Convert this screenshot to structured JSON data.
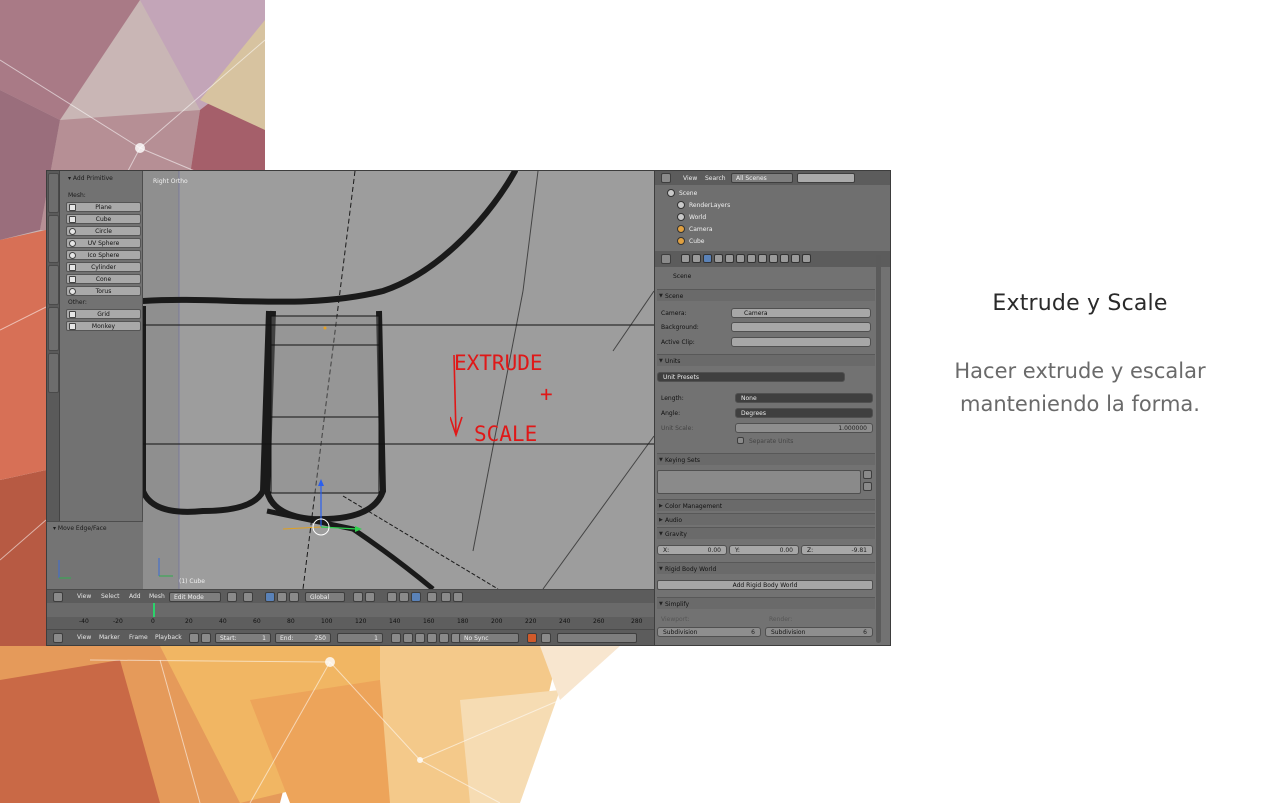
{
  "slide": {
    "title": "Extrude y Scale",
    "body": "Hacer extrude y escalar manteniendo la forma."
  },
  "colors": {
    "annotation_red": "#e01818",
    "blender_gray": "#727272",
    "viewport_gray": "#9d9d9d",
    "timeline_cursor": "#2bd36b"
  },
  "annotation": {
    "line1": "EXTRUDE",
    "line2": "+",
    "line3": "SCALE"
  },
  "tool_shelf": {
    "header": "▾ Add Primitive",
    "mesh_label": "Mesh:",
    "primitives": [
      "Plane",
      "Cube",
      "Circle",
      "UV Sphere",
      "Ico Sphere",
      "Cylinder",
      "Cone",
      "Torus"
    ],
    "other_label": "Other:",
    "others": [
      "Grid",
      "Monkey"
    ],
    "operator_panel": "▾ Move Edge/Face"
  },
  "viewport": {
    "view_name": "Right Ortho",
    "object_label": "(1) Cube",
    "header": {
      "view": "View",
      "select": "Select",
      "add": "Add",
      "mesh": "Mesh",
      "mode": "Edit Mode",
      "pivot": "Global"
    }
  },
  "timeline": {
    "ticks": [
      "-40",
      "-20",
      "0",
      "20",
      "40",
      "60",
      "80",
      "100",
      "120",
      "140",
      "160",
      "180",
      "200",
      "220",
      "240",
      "260",
      "280"
    ],
    "header": {
      "view": "View",
      "marker": "Marker",
      "frame": "Frame",
      "playback": "Playback",
      "start": "Start:",
      "start_val": "1",
      "end": "End:",
      "end_val": "250",
      "current": "1",
      "sync": "No Sync"
    }
  },
  "outliner": {
    "view": "View",
    "search": "Search",
    "filter": "All Scenes",
    "rows": [
      "Scene",
      "RenderLayers",
      "World",
      "Camera",
      "Cube"
    ]
  },
  "properties": {
    "context": "Scene",
    "scene_panel": "Scene",
    "camera_label": "Camera:",
    "camera_value": "Camera",
    "background_label": "Background:",
    "active_clip_label": "Active Clip:",
    "units_panel": "Units",
    "unit_presets": "Unit Presets",
    "length_label": "Length:",
    "length_value": "None",
    "angle_label": "Angle:",
    "angle_value": "Degrees",
    "unit_scale_label": "Unit Scale:",
    "unit_scale_value": "1.000000",
    "separate_units": "Separate Units",
    "keying_sets_panel": "Keying Sets",
    "color_management_panel": "Color Management",
    "audio_panel": "Audio",
    "gravity_panel": "Gravity",
    "gravity_x_label": "X:",
    "gravity_x": "0.00",
    "gravity_y_label": "Y:",
    "gravity_y": "0.00",
    "gravity_z_label": "Z:",
    "gravity_z": "-9.81",
    "rigid_body_panel": "Rigid Body World",
    "add_rigid_body": "Add Rigid Body World",
    "simplify_panel": "Simplify",
    "viewport_label": "Viewport:",
    "render_label": "Render:",
    "subdivision_label": "Subdivision",
    "subdivision_value": "6"
  }
}
